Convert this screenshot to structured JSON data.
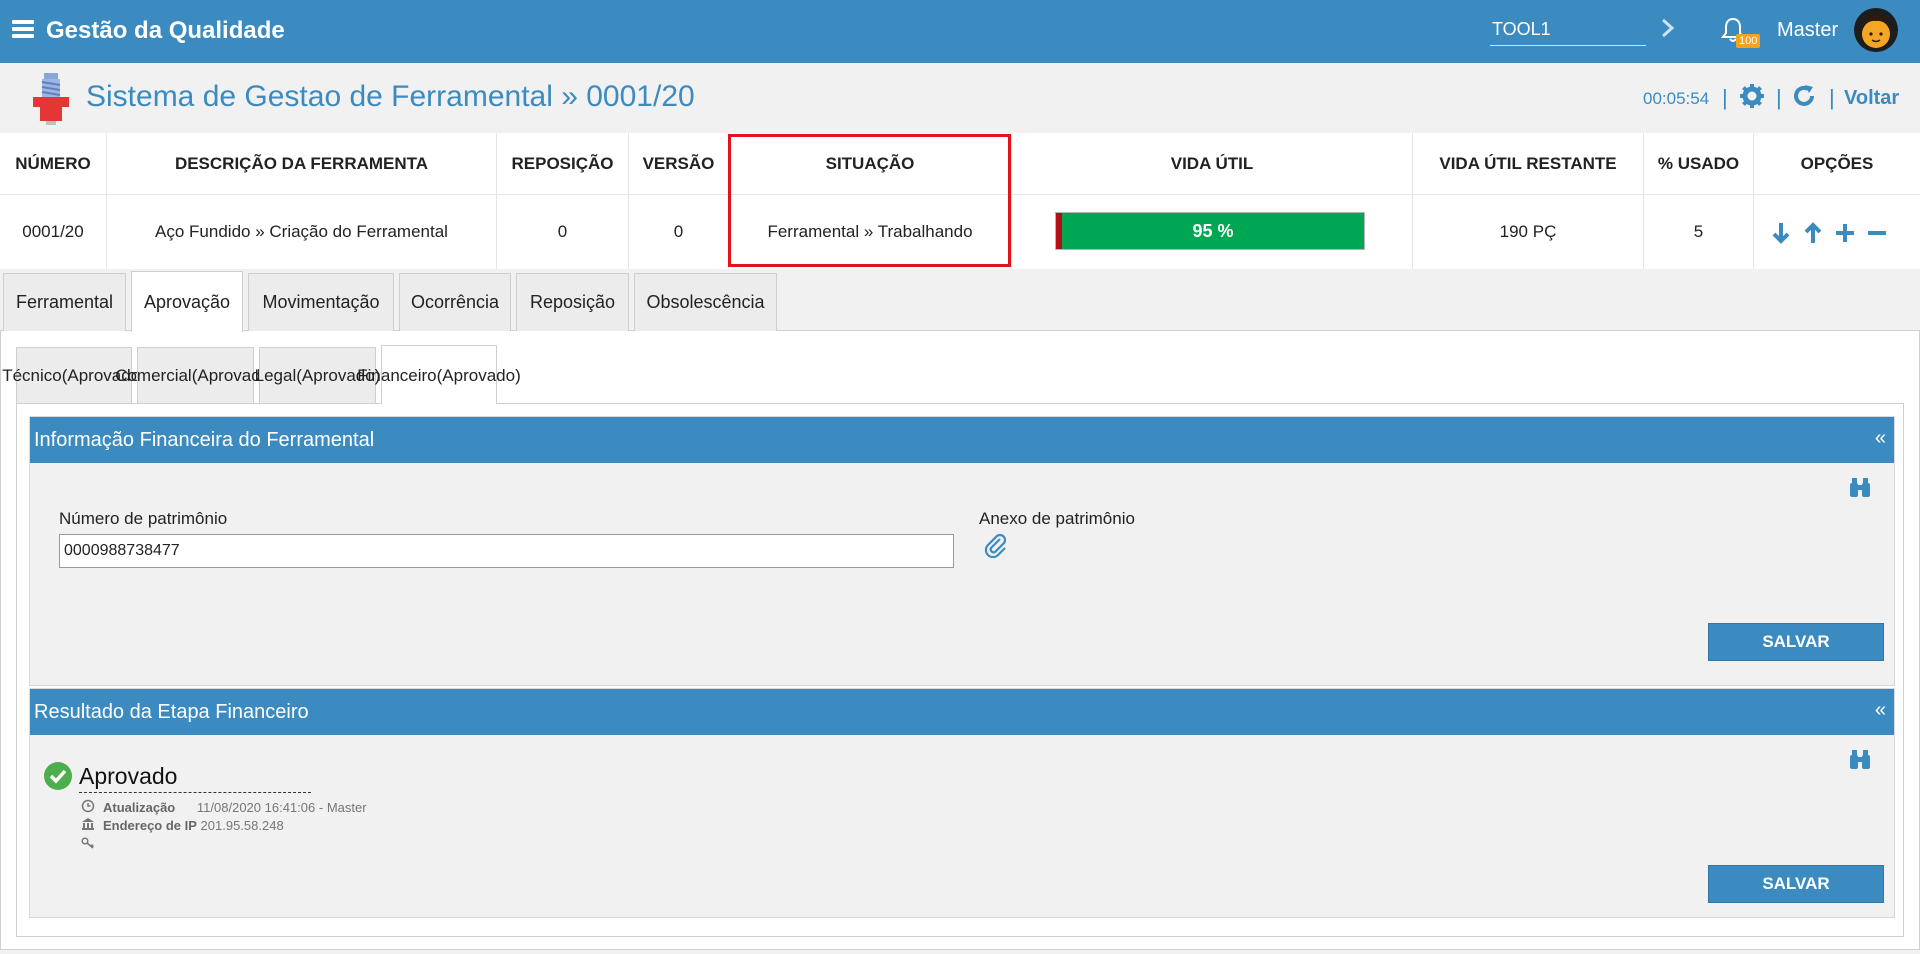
{
  "topbar": {
    "title": "Gestão da Qualidade",
    "tool_value": "TOOL1",
    "notification_count": "100",
    "user_name": "Master"
  },
  "header": {
    "title": "Sistema de Gestao de Ferramental » 0001/20",
    "timer": "00:05:54",
    "back_label": "Voltar"
  },
  "summary": {
    "headers": {
      "numero": "NÚMERO",
      "descricao": "DESCRIÇÃO DA FERRAMENTA",
      "reposicao": "REPOSIÇÃO",
      "versao": "VERSÃO",
      "situacao": "SITUAÇÃO",
      "vida_util": "VIDA ÚTIL",
      "vida_restante": "VIDA ÚTIL RESTANTE",
      "usado": "% USADO",
      "opcoes": "OPÇÕES"
    },
    "row": {
      "numero": "0001/20",
      "descricao": "Aço Fundido » Criação do Ferramental",
      "reposicao": "0",
      "versao": "0",
      "situacao": "Ferramental » Trabalhando",
      "vida_util_label": "95 %",
      "vida_util_percent": 95,
      "vida_restante": "190 PÇ",
      "usado": "5"
    }
  },
  "tabs": [
    {
      "label": "Ferramental",
      "active": false
    },
    {
      "label": "Aprovação",
      "active": true
    },
    {
      "label": "Movimentação",
      "active": false
    },
    {
      "label": "Ocorrência",
      "active": false
    },
    {
      "label": "Reposição",
      "active": false
    },
    {
      "label": "Obsolescência",
      "active": false
    }
  ],
  "subtabs": [
    {
      "line1": "Técnico",
      "line2": "(Aprovado)",
      "active": false
    },
    {
      "line1": "Comercial",
      "line2": "(Aprovado)",
      "active": false
    },
    {
      "line1": "Legal",
      "line2": "(Aprovado)",
      "active": false
    },
    {
      "line1": "Financeiro",
      "line2": "(Aprovado)",
      "active": true
    }
  ],
  "financial_info": {
    "title": "Informação Financeira do Ferramental",
    "collapse_label": "«",
    "patrimonio_label": "Número de patrimônio",
    "patrimonio_value": "0000988738477",
    "anexo_label": "Anexo de patrimônio",
    "save_label": "SALVAR"
  },
  "result": {
    "title": "Resultado da Etapa Financeiro",
    "collapse_label": "«",
    "status": "Aprovado",
    "update_label": "Atualização",
    "update_value": "11/08/2020 16:41:06",
    "update_user": "- Master",
    "ip_label": "Endereço de IP",
    "ip_value": "201.95.58.248",
    "save_label": "SALVAR"
  },
  "colors": {
    "primary": "#3b8bc0",
    "highlight": "#e0131d",
    "success": "#00a651",
    "danger": "#b30f12",
    "badge": "#f6a21b"
  }
}
